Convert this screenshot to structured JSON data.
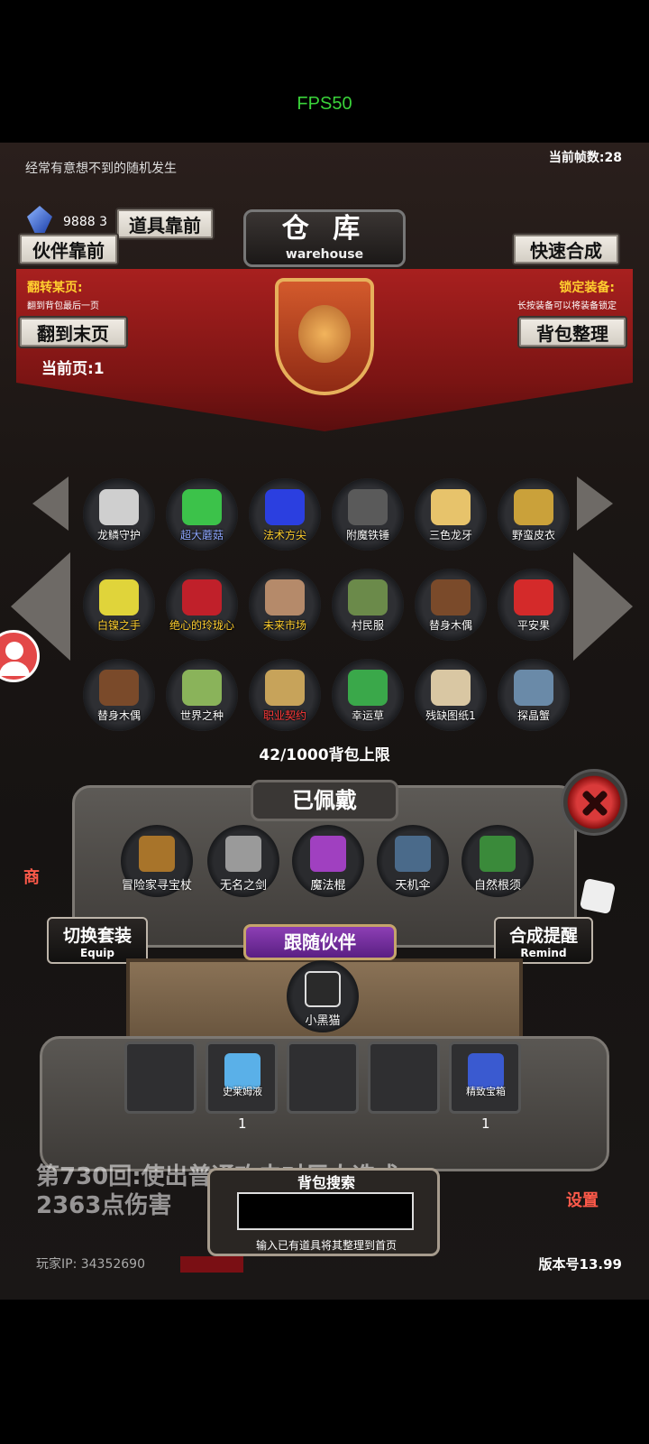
{
  "fps": "FPS50",
  "top": {
    "hint": "经常有意想不到的随机发生",
    "frame_count": "当前帧数:28",
    "gem_count": "9888 3"
  },
  "buttons": {
    "item_prev": "道具靠前",
    "companion_prev": "伙伴靠前",
    "quick_synth": "快速合成",
    "last_page": "翻到末页",
    "bag_sort": "背包整理"
  },
  "title": {
    "zh": "仓 库",
    "en": "warehouse"
  },
  "labels": {
    "flip_page": "翻转某页:",
    "flip_note": "翻到背包最后一页",
    "lock_equip": "锁定装备:",
    "lock_note": "长按装备可以将装备锁定",
    "current_page": "当前页:1"
  },
  "warehouse_items": [
    {
      "name": "龙鳞守护",
      "icon": "dragon-mask-icon",
      "color": "#cfcfcf",
      "name_color": "#ffffff"
    },
    {
      "name": "超大蘑菇",
      "icon": "mushroom-icon",
      "color": "#3cc24a",
      "name_color": "#8fa8ff"
    },
    {
      "name": "法术方尖",
      "icon": "obelisk-icon",
      "color": "#2b3fe0",
      "name_color": "#ffcf2f"
    },
    {
      "name": "附魔铁锤",
      "icon": "hammer-icon",
      "color": "#5a5a5a",
      "name_color": "#ffffff"
    },
    {
      "name": "三色龙牙",
      "icon": "dragon-fang-icon",
      "color": "#e7c36b",
      "name_color": "#ffffff"
    },
    {
      "name": "野蛮皮衣",
      "icon": "fur-coat-icon",
      "color": "#caa13a",
      "name_color": "#ffffff"
    },
    {
      "name": "白镍之手",
      "icon": "gauntlet-icon",
      "color": "#e0d43a",
      "name_color": "#ffcf2f"
    },
    {
      "name": "绝心的玲珑心",
      "icon": "heart-gem-icon",
      "color": "#c0202a",
      "name_color": "#ffcf2f"
    },
    {
      "name": "未来市场",
      "icon": "market-icon",
      "color": "#b58a6a",
      "name_color": "#ffcf2f"
    },
    {
      "name": "村民服",
      "icon": "villager-clothes-icon",
      "color": "#6b8a4a",
      "name_color": "#ffffff"
    },
    {
      "name": "替身木偶",
      "icon": "puppet-icon",
      "color": "#7a4a2a",
      "name_color": "#ffffff"
    },
    {
      "name": "平安果",
      "icon": "apple-icon",
      "color": "#d42a2a",
      "name_color": "#ffffff"
    },
    {
      "name": "替身木偶",
      "icon": "puppet-icon",
      "color": "#7a4a2a",
      "name_color": "#ffffff"
    },
    {
      "name": "世界之种",
      "icon": "seed-icon",
      "color": "#8ab35a",
      "name_color": "#ffffff"
    },
    {
      "name": "职业契约",
      "icon": "contract-scroll-icon",
      "color": "#c7a35a",
      "name_color": "#ff3a3a"
    },
    {
      "name": "幸运草",
      "icon": "clover-icon",
      "color": "#3aa84a",
      "name_color": "#ffffff"
    },
    {
      "name": "残缺图纸1",
      "icon": "blueprint-scroll-icon",
      "color": "#d9c7a3",
      "name_color": "#ffffff"
    },
    {
      "name": "探晶蟹",
      "icon": "crab-icon",
      "color": "#6a8aa8",
      "name_color": "#ffffff"
    }
  ],
  "capacity": "42/1000背包上限",
  "equipped": {
    "title": "已佩戴",
    "items": [
      {
        "name": "冒险家寻宝杖",
        "icon": "staff-icon",
        "color": "#a8742a"
      },
      {
        "name": "无名之剑",
        "icon": "sword-icon",
        "color": "#9a9a9a"
      },
      {
        "name": "魔法棍",
        "icon": "magic-rod-icon",
        "color": "#a040c0"
      },
      {
        "name": "天机伞",
        "icon": "umbrella-icon",
        "color": "#4a6a8a"
      },
      {
        "name": "自然根须",
        "icon": "root-boots-icon",
        "color": "#3a8a3a"
      }
    ]
  },
  "side": {
    "switch_zh": "切换套装",
    "switch_en": "Equip",
    "remind_zh": "合成提醒",
    "remind_en": "Remind"
  },
  "companion": {
    "title": "跟随伙伴",
    "name": "小黑猫",
    "icon": "black-cat-icon"
  },
  "bag_items": [
    {
      "name": "",
      "count": ""
    },
    {
      "name": "史莱姆液",
      "icon": "potion-icon",
      "color": "#5ab0e8",
      "count": "1"
    },
    {
      "name": "",
      "count": ""
    },
    {
      "name": "",
      "count": ""
    },
    {
      "name": "精致宝箱",
      "icon": "chest-icon",
      "color": "#3a5ad0",
      "count": "1"
    }
  ],
  "log": {
    "line1": "第730回:使出普通攻击对巨人造成",
    "line2": "2363点伤害"
  },
  "search": {
    "title": "背包搜索",
    "placeholder": "",
    "hint": "输入已有道具将其整理到首页"
  },
  "footer": {
    "player_ip": "玩家IP: 34352690",
    "version": "版本号13.99",
    "shop": "商",
    "settings": "设置"
  }
}
